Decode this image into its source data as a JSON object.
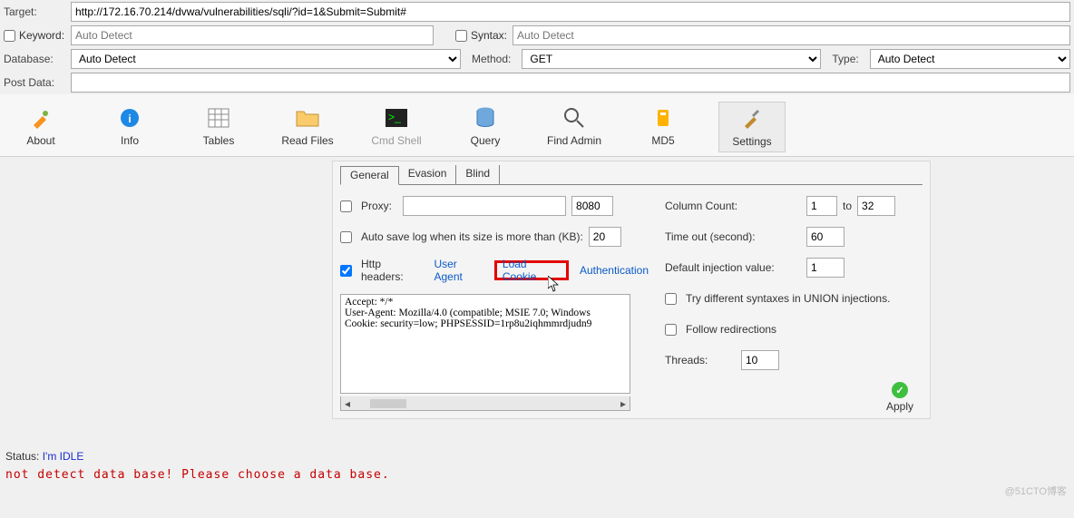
{
  "form": {
    "target_label": "Target:",
    "target_value": "http://172.16.70.214/dvwa/vulnerabilities/sqli/?id=1&Submit=Submit#",
    "keyword_label": "Keyword:",
    "keyword_placeholder": "Auto Detect",
    "syntax_label": "Syntax:",
    "syntax_placeholder": "Auto Detect",
    "database_label": "Database:",
    "database_value": "Auto Detect",
    "method_label": "Method:",
    "method_value": "GET",
    "type_label": "Type:",
    "type_value": "Auto Detect",
    "postdata_label": "Post Data:",
    "postdata_value": ""
  },
  "toolbar": {
    "about": "About",
    "info": "Info",
    "tables": "Tables",
    "readfiles": "Read Files",
    "cmdshell": "Cmd Shell",
    "query": "Query",
    "findadmin": "Find Admin",
    "md5": "MD5",
    "settings": "Settings"
  },
  "tabs": {
    "general": "General",
    "evasion": "Evasion",
    "blind": "Blind"
  },
  "settings": {
    "proxy_label": "Proxy:",
    "proxy_host": "",
    "proxy_port": "8080",
    "autosave_label": "Auto save log when its size is more than (KB):",
    "autosave_kb": "20",
    "httpheaders_label": "Http headers:",
    "useragent_link": "User Agent",
    "loadcookie_link": "Load Cookie",
    "authentication_link": "Authentication",
    "headers_text": "Accept: */*\nUser-Agent: Mozilla/4.0 (compatible; MSIE 7.0; Windows\nCookie: security=low; PHPSESSID=1rp8u2iqhmmrdjudn9",
    "colcount_label": "Column Count:",
    "colcount_from": "1",
    "colcount_to_label": "to",
    "colcount_to": "32",
    "timeout_label": "Time out (second):",
    "timeout_value": "60",
    "definj_label": "Default injection value:",
    "definj_value": "1",
    "trydiff_label": "Try different syntaxes in UNION injections.",
    "followredir_label": "Follow redirections",
    "threads_label": "Threads:",
    "threads_value": "10",
    "apply_label": "Apply"
  },
  "status": {
    "label": "Status:",
    "value": "I'm IDLE",
    "error": "not detect data base! Please choose a data base."
  },
  "watermark": "@51CTO博客"
}
